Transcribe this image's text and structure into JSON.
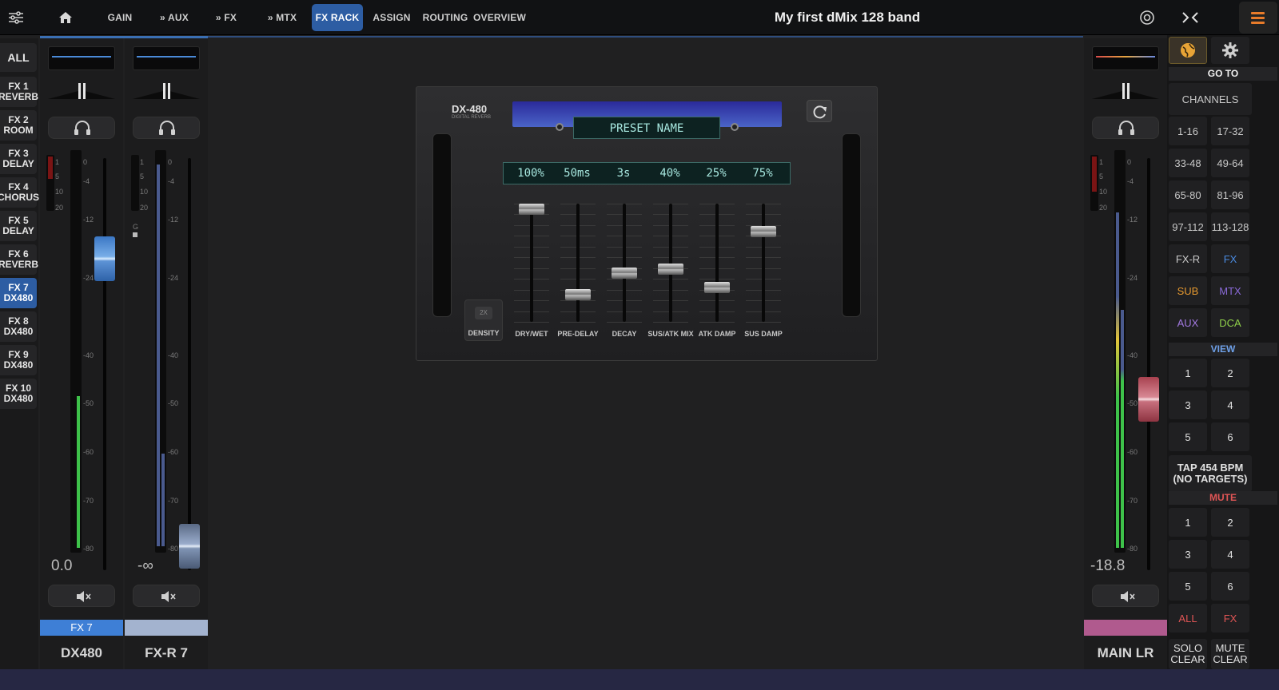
{
  "topbar": {
    "title": "My first dMix 128 band",
    "tabs": [
      {
        "label": "GAIN"
      },
      {
        "label": "» AUX"
      },
      {
        "label": "» FX"
      },
      {
        "label": "» MTX"
      },
      {
        "label": "FX RACK",
        "active": true
      },
      {
        "label": "ASSIGN"
      },
      {
        "label": "ROUTING"
      },
      {
        "label": "OVERVIEW"
      }
    ]
  },
  "fx_list": {
    "all": "ALL",
    "items": [
      {
        "line1": "FX 1",
        "line2": "REVERB"
      },
      {
        "line1": "FX 2",
        "line2": "ROOM"
      },
      {
        "line1": "FX 3",
        "line2": "DELAY"
      },
      {
        "line1": "FX 4",
        "line2": "CHORUS"
      },
      {
        "line1": "FX 5",
        "line2": "DELAY"
      },
      {
        "line1": "FX 6",
        "line2": "REVERB"
      },
      {
        "line1": "FX 7",
        "line2": "DX480",
        "active": true
      },
      {
        "line1": "FX 8",
        "line2": "DX480"
      },
      {
        "line1": "FX 9",
        "line2": "DX480"
      },
      {
        "line1": "FX 10",
        "line2": "DX480"
      }
    ]
  },
  "meter_scale": [
    "0",
    "-4",
    "-12",
    "-24",
    "-40",
    "-50",
    "-60",
    "-70",
    "-80"
  ],
  "gr_scale": [
    "1",
    "5",
    "10",
    "20"
  ],
  "strips": {
    "fx7": {
      "value": "0.0",
      "tag": "FX 7",
      "name": "DX480",
      "fader_db": "-19.5"
    },
    "fxr7": {
      "value": "-∞",
      "tag": "",
      "name": "FX-R 7",
      "gate_label": "G"
    },
    "main": {
      "value": "-18.8",
      "name": "MAIN LR"
    }
  },
  "plugin": {
    "model": "DX-480",
    "subtitle": "DIGITAL REVERB",
    "preset_name": "PRESET NAME",
    "density_badge": "2X",
    "density_label": "DENSITY",
    "params": [
      {
        "label": "DRY/WET",
        "display": "100%",
        "fraction": 1.0
      },
      {
        "label": "PRE-DELAY",
        "display": "50ms",
        "fraction": 0.2
      },
      {
        "label": "DECAY",
        "display": "3s",
        "fraction": 0.4
      },
      {
        "label": "SUS/ATK MIX",
        "display": "40%",
        "fraction": 0.44
      },
      {
        "label": "ATK DAMP",
        "display": "25%",
        "fraction": 0.27
      },
      {
        "label": "SUS DAMP",
        "display": "75%",
        "fraction": 0.79
      }
    ]
  },
  "right_panel": {
    "goto": "GO TO",
    "channels": "CHANNELS",
    "ranges": [
      "1-16",
      "17-32",
      "33-48",
      "49-64",
      "65-80",
      "81-96",
      "97-112",
      "113-128"
    ],
    "groups": [
      {
        "label": "FX-R",
        "color": "#c9c9c9"
      },
      {
        "label": "FX",
        "color": "#4a8ae0"
      },
      {
        "label": "SUB",
        "color": "#e6992f"
      },
      {
        "label": "MTX",
        "color": "#8a6ad8"
      },
      {
        "label": "AUX",
        "color": "#a279e0"
      },
      {
        "label": "DCA",
        "color": "#8fd04a"
      }
    ],
    "view": "VIEW",
    "view_buttons": [
      "1",
      "2",
      "3",
      "4",
      "5",
      "6"
    ],
    "tap_line1": "TAP 454 BPM",
    "tap_line2": "(NO TARGETS)",
    "mute": "MUTE",
    "mute_buttons": [
      "1",
      "2",
      "3",
      "4",
      "5",
      "6"
    ],
    "mute_all": "ALL",
    "mute_fx": "FX",
    "solo_clear_1": "SOLO",
    "solo_clear_2": "CLEAR",
    "mute_clear_1": "MUTE",
    "mute_clear_2": "CLEAR"
  },
  "colors": {
    "accent": "#2d5da3",
    "mute": "#e05555",
    "meter_green": "#3ec24a",
    "fader_blue": "#6fa8e0",
    "fader_red": "#d47a88"
  }
}
